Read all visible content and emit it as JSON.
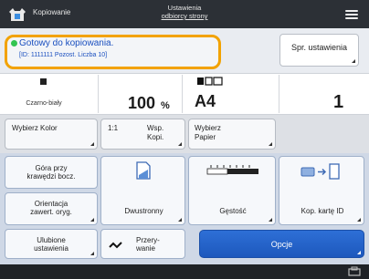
{
  "header": {
    "app_title": "Kopiowanie",
    "title_right_line1": "Ustawienia",
    "title_right_line2": "odbiorcy strony",
    "app_icon": "copy-app-icon",
    "menu_icon": "hamburger-menu-icon"
  },
  "status": {
    "message": "Gotowy do kopiowania.",
    "sub": "[ID: 1111111 Pozost. Liczba   10]",
    "check_settings_label": "Spr. ustawienia",
    "dot_color": "#31c451",
    "highlight_color": "#f2a200"
  },
  "settings": {
    "color_mode_label": "Czarno-biały",
    "ratio": "100",
    "ratio_unit": "%",
    "paper": "A4",
    "copies": "1"
  },
  "buttons": {
    "select_color": "Wybierz Kolor",
    "ratio_1_1": "1:1",
    "copy_ratio_line1": "Wsp.",
    "copy_ratio_line2": "Kopi.",
    "select_paper_line1": "Wybierz",
    "select_paper_line2": "Papier",
    "top_edge_line1": "Góra przy",
    "top_edge_line2": "krawędzi bocz.",
    "orientation_line1": "Orientacja",
    "orientation_line2": "zawert. oryg.",
    "duplex": "Dwustronny",
    "density": "Gęstość",
    "id_card": "Kop. kartę ID",
    "favorites_line1": "Ulubione",
    "favorites_line2": "ustawienia",
    "interrupt_line1": "Przery-",
    "interrupt_line2": "wanie",
    "options": "Opcje"
  },
  "colors": {
    "accent_blue": "#1d58bd",
    "status_text": "#1a4fbf"
  }
}
